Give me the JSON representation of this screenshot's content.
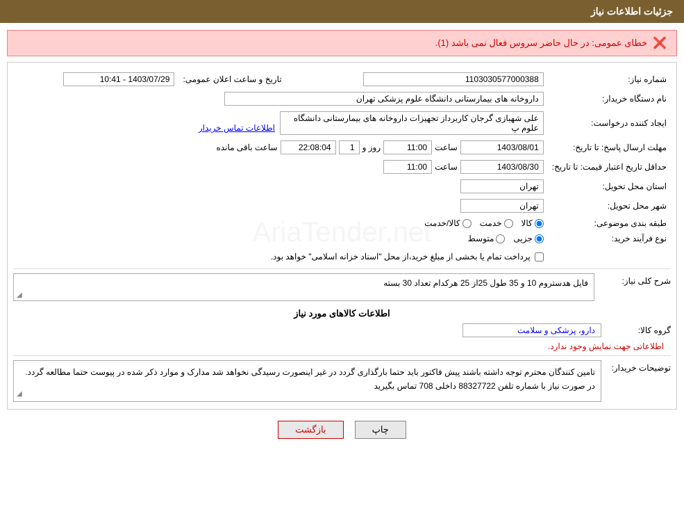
{
  "header": {
    "title": "جزئیات اطلاعات نیاز"
  },
  "error": {
    "message": "خطای عمومی: در حال حاضر سروس فعال نمی باشد (1)."
  },
  "form": {
    "shomareNiaz_label": "شماره نیاز:",
    "shomareNiaz_value": "1103030577000388",
    "tarikhLabel": "تاریخ و ساعت اعلان عمومی:",
    "tarikhValue": "1403/07/29 - 10:41",
    "namDastgahLabel": "نام دستگاه خریدار:",
    "namDastgahValue": "داروخانه های بیمارستانی دانشگاه علوم پزشکی تهران",
    "ijadKonLabel": "ایجاد کننده درخواست:",
    "ijadKonValue": "علی شهبازی گرجان کاربرداز تجهیزات داروخانه های بیمارستانی دانشگاه علوم پ",
    "ijadKonLink": "اطلاعات تماس خریدار",
    "mohlat_label": "مهلت ارسال پاسخ: تا تاریخ:",
    "mohlat_date": "1403/08/01",
    "mohlat_saat_label": "ساعت",
    "mohlat_saat": "11:00",
    "mohlat_rooz_label": "روز و",
    "mohlat_rooz": "1",
    "mohlat_mande_label": "ساعت باقی مانده",
    "mohlat_mande": "22:08:04",
    "hadaghal_label": "حداقل تاریخ اعتبار قیمت: تا تاریخ:",
    "hadaghal_date": "1403/08/30",
    "hadaghal_saat_label": "ساعت",
    "hadaghal_saat": "11:00",
    "ostan_label": "استان محل تحویل:",
    "ostan_value": "تهران",
    "shahr_label": "شهر محل تحویل:",
    "shahr_value": "تهران",
    "tabaghe_label": "طبقه بندی موضوعی:",
    "tabaghe_options": [
      "کالا",
      "خدمت",
      "کالا/خدمت"
    ],
    "tabaghe_selected": "کالا",
    "navFarayand_label": "نوع فرآیند خرید:",
    "navFarayand_options": [
      "جزیی",
      "متوسط"
    ],
    "navFarayand_selected": "جزیی",
    "checkbox_label": "پرداخت تمام یا بخشی از مبلغ خرید،از محل \"اسناد خزانه اسلامی\" خواهد بود.",
    "sharhKoli_label": "شرح کلی نیاز:",
    "sharhKoli_value": "فایل هدستروم 10 و 35 طول 25از 25 هرکدام تعداد 30 بسته",
    "kalaInfo_title": "اطلاعات کالاهای مورد نیاز",
    "groupKala_label": "گروه کالا:",
    "groupKala_value": "دارو، پزشکی و سلامت",
    "noInfo_text": "اطلاعاتی جهت نمایش وجود ندارد.",
    "tozi_label": "توضیحات خریدار:",
    "tozi_value": "تامین کنندگان محترم توجه داشته باشند پیش فاکتور باید حتما بارگذاری گردد در غیر اینصورت رسیدگی نخواهد شد مدارک و موارد ذکر شده در پیوست حتما مطالعه گردد. در صورت نیاز با شماره تلفن 88327722 داخلی 708 تماس بگیرید",
    "btn_print": "چاپ",
    "btn_back": "بازگشت"
  }
}
